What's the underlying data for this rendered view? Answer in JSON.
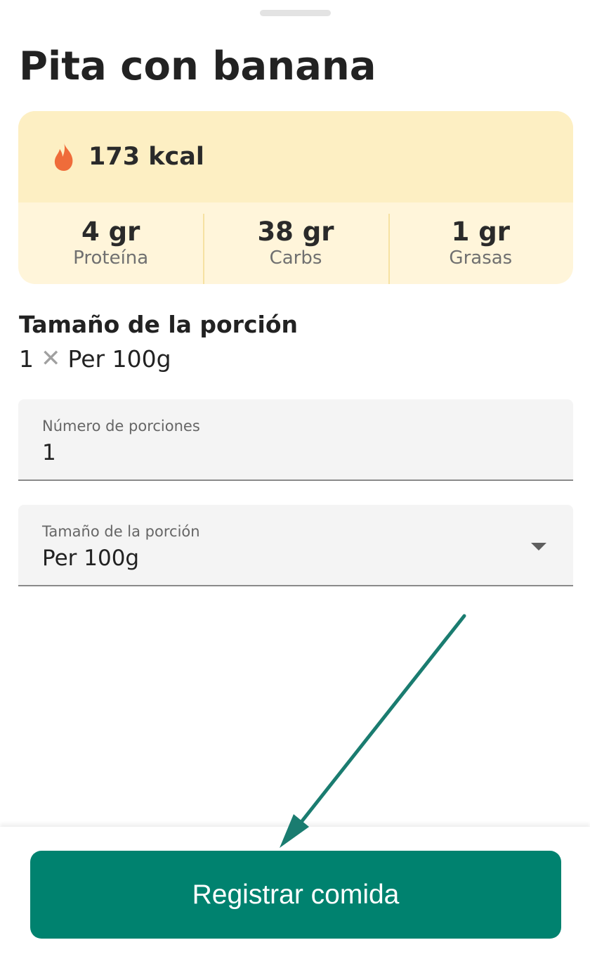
{
  "food": {
    "name": "Pita con banana",
    "calories": "173 kcal",
    "calorie_icon": "flame-icon",
    "macros": [
      {
        "value": "4 gr",
        "label": "Proteína"
      },
      {
        "value": "38 gr",
        "label": "Carbs"
      },
      {
        "value": "1 gr",
        "label": "Grasas"
      }
    ]
  },
  "serving": {
    "heading": "Tamaño de la porción",
    "summary_count": "1",
    "summary_times": "✕",
    "summary_unit": "Per 100g"
  },
  "fields": {
    "servings": {
      "label": "Número de porciones",
      "value": "1"
    },
    "size": {
      "label": "Tamaño de la porción",
      "value": "Per 100g"
    }
  },
  "actions": {
    "log_label": "Registrar comida"
  },
  "colors": {
    "accent": "#00826f",
    "card_top": "#fdefc3",
    "card_bottom": "#fff5da",
    "flame": "#ef6c3a",
    "arrow": "#1a7c70"
  }
}
